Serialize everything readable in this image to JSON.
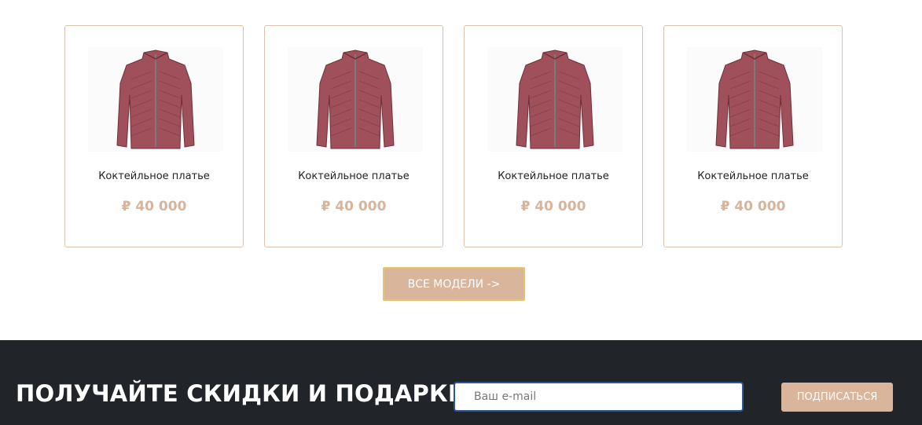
{
  "products": [
    {
      "name": "Коктейльное платье",
      "price": "₽ 40 000",
      "image": "jacket-image"
    },
    {
      "name": "Коктейльное платье",
      "price": "₽ 40 000",
      "image": "jacket-image"
    },
    {
      "name": "Коктейльное платье",
      "price": "₽ 40 000",
      "image": "jacket-image"
    },
    {
      "name": "Коктейльное платье",
      "price": "₽ 40 000",
      "image": "jacket-image"
    }
  ],
  "all_models_label": "ВСЕ МОДЕЛИ ->",
  "footer": {
    "promo_text": "ПОЛУЧАЙТЕ СКИДКИ И ПОДАРКИ",
    "email_placeholder": "Ваш e-mail",
    "email_value": "",
    "subscribe_label": "ПОДПИСАТЬСЯ"
  },
  "colors": {
    "accent": "#d9b59b",
    "price": "#d7b49a",
    "card_border": "#d9c3ad",
    "footer_bg": "#212429",
    "jacket": "#a0505a"
  }
}
